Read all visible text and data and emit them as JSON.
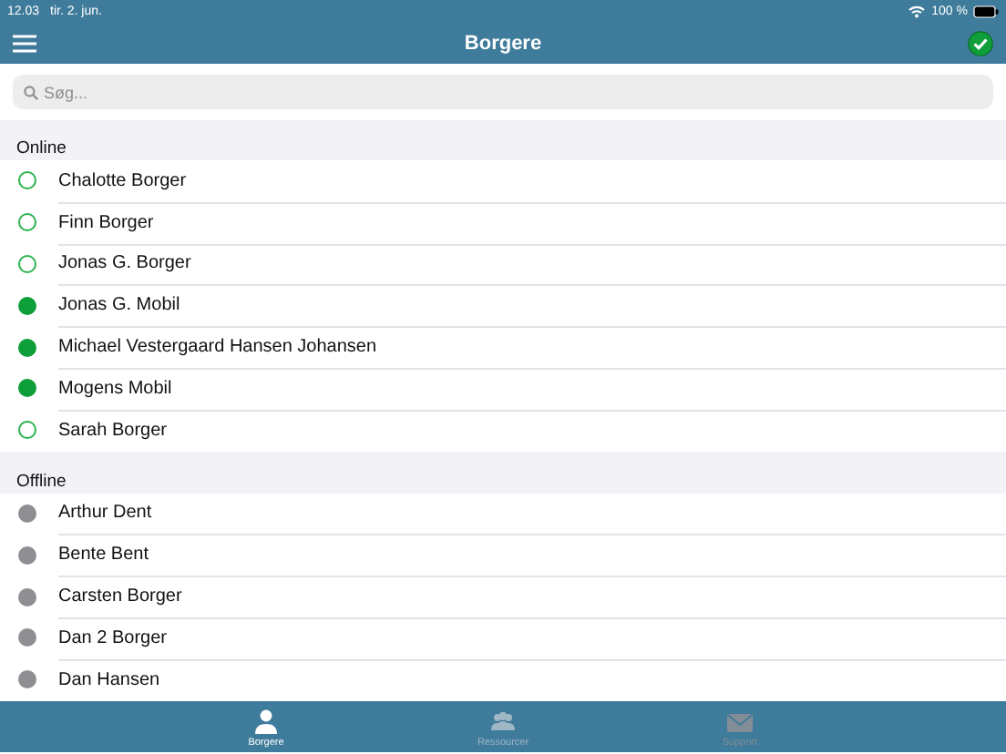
{
  "status_bar": {
    "time": "12.03",
    "date": "tir. 2. jun.",
    "battery": "100 %"
  },
  "nav_bar": {
    "title": "Borgere"
  },
  "search": {
    "placeholder": "Søg..."
  },
  "sections": [
    {
      "title": "Online",
      "people": [
        {
          "name": "Chalotte Borger",
          "filled": false,
          "color": "#2bb24c"
        },
        {
          "name": "Finn Borger",
          "filled": false,
          "color": "#2bb24c"
        },
        {
          "name": "Jonas G. Borger",
          "filled": false,
          "color": "#2bb24c"
        },
        {
          "name": "Jonas G. Mobil",
          "filled": true,
          "color": "#0e9e3a"
        },
        {
          "name": "Michael Vestergaard Hansen Johansen",
          "filled": true,
          "color": "#0e9e3a"
        },
        {
          "name": "Mogens Mobil",
          "filled": true,
          "color": "#0e9e3a"
        },
        {
          "name": "Sarah Borger",
          "filled": false,
          "color": "#2bb24c"
        }
      ]
    },
    {
      "title": "Offline",
      "people": [
        {
          "name": "Arthur Dent",
          "filled": true,
          "color": "#8e8e93"
        },
        {
          "name": "Bente Bent",
          "filled": true,
          "color": "#8e8e93"
        },
        {
          "name": "Carsten Borger",
          "filled": true,
          "color": "#8e8e93"
        },
        {
          "name": "Dan 2 Borger",
          "filled": true,
          "color": "#8e8e93"
        },
        {
          "name": "Dan Hansen",
          "filled": true,
          "color": "#8e8e93"
        }
      ]
    }
  ],
  "tabs": [
    {
      "label": "Borgere",
      "kind": "person",
      "selected": true
    },
    {
      "label": "Ressourcer",
      "kind": "group",
      "selected": false
    },
    {
      "label": "Support",
      "kind": "mail",
      "selected": false
    }
  ]
}
